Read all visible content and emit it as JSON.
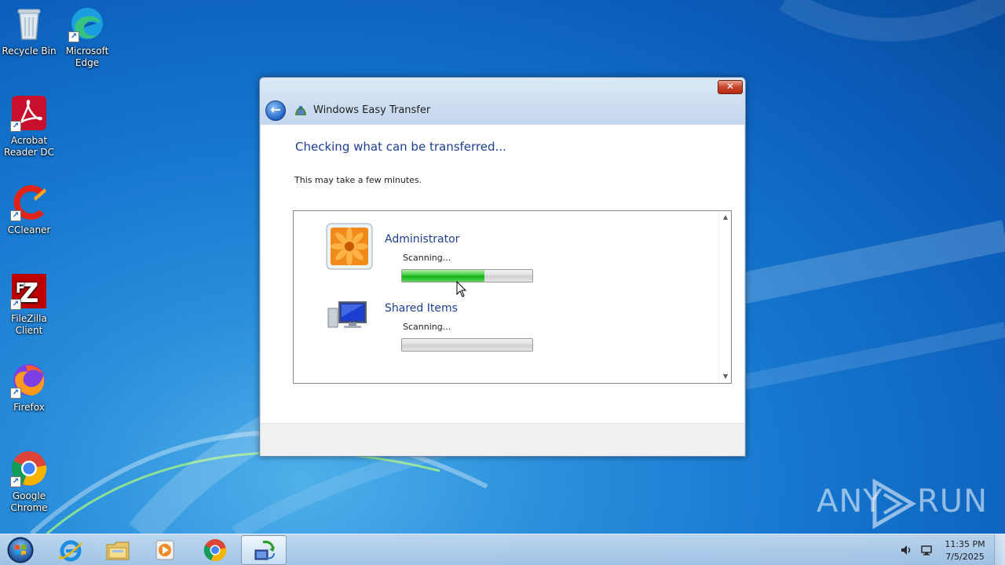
{
  "desktop": {
    "icons": [
      {
        "label": "Recycle Bin",
        "icon": "recycle-bin-icon"
      },
      {
        "label": "Microsoft Edge",
        "icon": "edge-icon"
      },
      {
        "label": "Acrobat Reader DC",
        "icon": "acrobat-icon"
      },
      {
        "label": "CCleaner",
        "icon": "ccleaner-icon"
      },
      {
        "label": "FileZilla Client",
        "icon": "filezilla-icon"
      },
      {
        "label": "Firefox",
        "icon": "firefox-icon"
      },
      {
        "label": "Google Chrome",
        "icon": "chrome-icon"
      }
    ]
  },
  "dialog": {
    "title": "Windows Easy Transfer",
    "close_label": "✕",
    "back_label": "←",
    "heading": "Checking what can be transferred...",
    "subtext": "This may take a few minutes.",
    "items": [
      {
        "name": "Administrator",
        "status": "Scanning...",
        "progress": 0.63
      },
      {
        "name": "Shared Items",
        "status": "Scanning...",
        "progress": 0.0
      }
    ]
  },
  "watermark": {
    "left": "ANY",
    "right": "RUN"
  },
  "taskbar": {
    "apps": [
      "start-orb-icon",
      "internet-explorer-icon",
      "file-explorer-icon",
      "media-player-icon",
      "chrome-icon",
      "easy-transfer-icon"
    ],
    "active_app": "easy-transfer-icon",
    "time": "11:35 PM",
    "date": "7/5/2025"
  },
  "colors": {
    "heading": "#1e3f8f",
    "progress_fill": "#14b014",
    "close_button": "#c7452d"
  }
}
